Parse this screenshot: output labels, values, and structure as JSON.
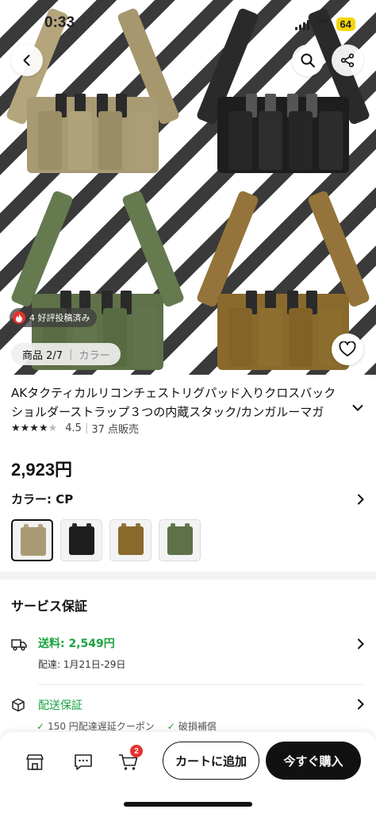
{
  "status_bar": {
    "time": "0:33",
    "battery": "64"
  },
  "gallery": {
    "review_badge": "4 好評投稿済み",
    "counter": "商品 2/7",
    "counter_label": "カラー"
  },
  "product": {
    "title": "AKタクティカルリコンチェストリグパッド入りクロスバックショルダーストラップ３つの内蔵スタック/カンガルーマガ",
    "rating": "4.5",
    "sold": "37 点販売",
    "price": "2,923円",
    "color_label": "カラー: CP",
    "swatches": [
      "CP",
      "Black",
      "Tan",
      "Green"
    ]
  },
  "service": {
    "title": "サービス保証",
    "shipping": "送料:  2,549円",
    "delivery": "配達: 1月21日-29日",
    "guarantee": "配送保証",
    "guarantee_items": [
      "150 円配達遅延クーポン",
      "破損補償"
    ]
  },
  "bottom_bar": {
    "cart_count": "2",
    "add_to_cart": "カートに追加",
    "buy_now": "今すぐ購入"
  },
  "colors": {
    "multicam": "#a89a72",
    "black": "#1e1e1e",
    "coyote": "#8a6a2c",
    "olive": "#5f7148",
    "accent_green": "#1aa341",
    "badge_red": "#e5322d"
  }
}
